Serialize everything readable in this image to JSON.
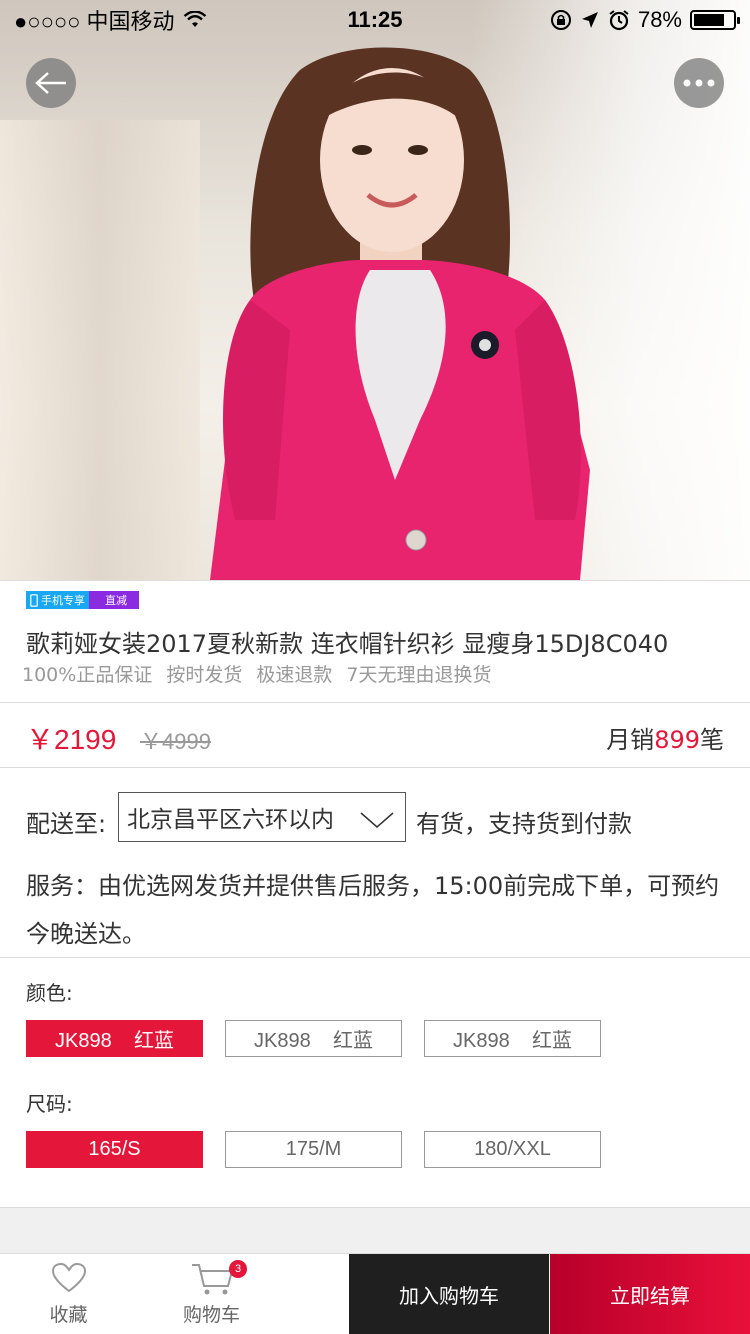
{
  "status_bar": {
    "carrier": "●○○○○ 中国移动",
    "time": "11:25",
    "battery_text": "78%",
    "battery_level": 0.78
  },
  "product": {
    "badge_mobile": "手机专享",
    "badge_direct": "直减",
    "title": "歌莉娅女装2017夏秋新款 连衣帽针织衫 显瘦身15DJ8C040",
    "guarantees": [
      "100%正品保证",
      "按时发货",
      "极速退款",
      "7天无理由退换货"
    ],
    "price": "￥2199",
    "old_price": "￥4999",
    "monthly_prefix": "月销",
    "monthly_count": "899",
    "monthly_suffix": "笔"
  },
  "delivery": {
    "label": "配送至:",
    "location": "北京昌平区六环以内",
    "stock": "有货，支持货到付款",
    "service": "服务：由优选网发货并提供售后服务，15:00前完成下单，可预约今晚送达。"
  },
  "color": {
    "label": "颜色:",
    "options": [
      "JK898    红蓝",
      "JK898    红蓝",
      "JK898    红蓝"
    ]
  },
  "size": {
    "label": "尺码:",
    "options": [
      "165/S",
      "175/M",
      "180/XXL"
    ]
  },
  "bottom_bar": {
    "favorite": "收藏",
    "cart": "购物车",
    "cart_count": "3",
    "add_to_cart": "加入购物车",
    "checkout": "立即结算"
  },
  "colors": {
    "accent": "#e4163a",
    "badge_blue": "#18a7f0",
    "badge_purple": "#8a2be2",
    "dark_button": "#1f1f1f"
  }
}
